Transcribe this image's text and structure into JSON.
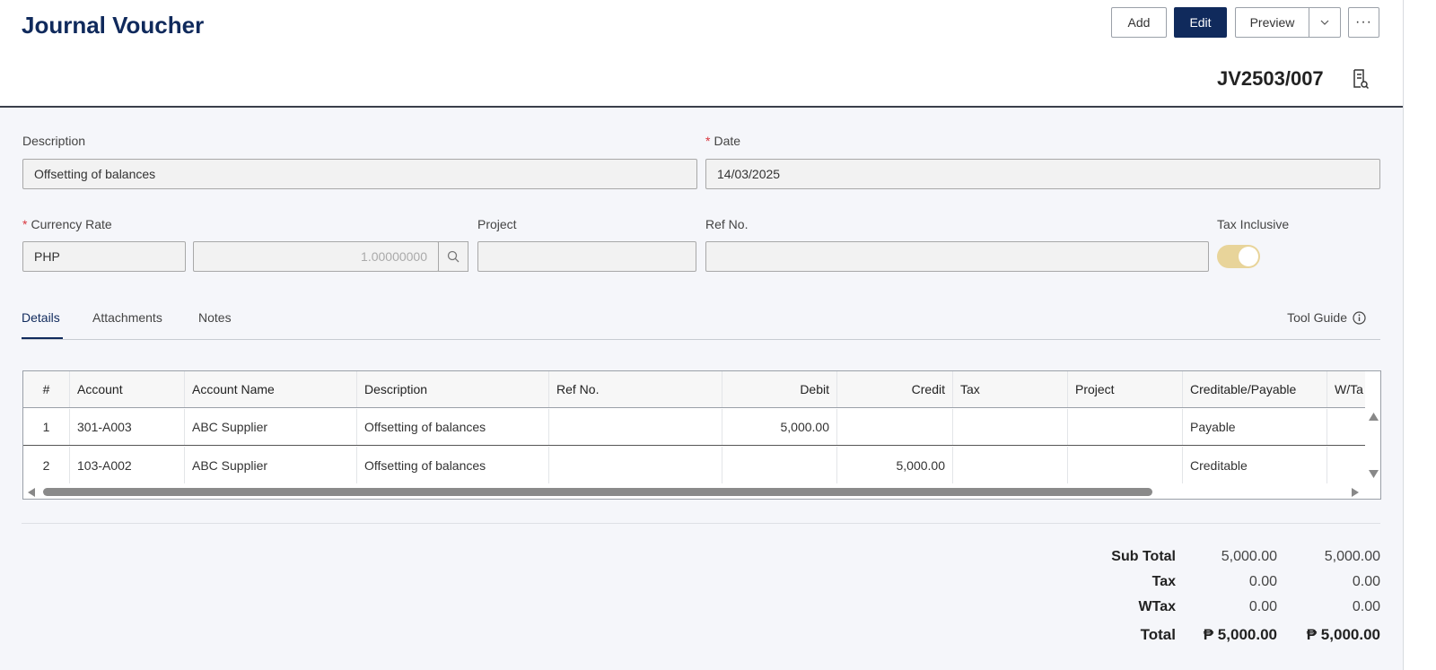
{
  "header": {
    "title": "Journal Voucher",
    "add_label": "Add",
    "edit_label": "Edit",
    "preview_label": "Preview",
    "more_label": "···",
    "doc_number": "JV2503/007"
  },
  "form": {
    "description_label": "Description",
    "description_value": "Offsetting of balances",
    "date_label": "Date",
    "date_value": "14/03/2025",
    "currency_rate_label": "Currency Rate",
    "currency_value": "PHP",
    "rate_value": "1.00000000",
    "project_label": "Project",
    "project_value": "",
    "ref_no_label": "Ref No.",
    "ref_no_value": "",
    "tax_inclusive_label": "Tax Inclusive",
    "tax_inclusive_on": true,
    "required_mark": "*"
  },
  "tabs": {
    "details": "Details",
    "attachments": "Attachments",
    "notes": "Notes",
    "tool_guide": "Tool Guide"
  },
  "table": {
    "columns": [
      "#",
      "Account",
      "Account Name",
      "Description",
      "Ref No.",
      "Debit",
      "Credit",
      "Tax",
      "Project",
      "Creditable/Payable",
      "W/Ta"
    ],
    "rows": [
      {
        "num": "1",
        "account": "301-A003",
        "account_name": "ABC Supplier",
        "description": "Offsetting of balances",
        "ref_no": "",
        "debit": "5,000.00",
        "credit": "",
        "tax": "",
        "project": "",
        "cp": "Payable",
        "wtax": ""
      },
      {
        "num": "2",
        "account": "103-A002",
        "account_name": "ABC Supplier",
        "description": "Offsetting of balances",
        "ref_no": "",
        "debit": "",
        "credit": "5,000.00",
        "tax": "",
        "project": "",
        "cp": "Creditable",
        "wtax": ""
      }
    ]
  },
  "totals": {
    "sub_total_label": "Sub Total",
    "sub_total_debit": "5,000.00",
    "sub_total_credit": "5,000.00",
    "tax_label": "Tax",
    "tax_debit": "0.00",
    "tax_credit": "0.00",
    "wtax_label": "WTax",
    "wtax_debit": "0.00",
    "wtax_credit": "0.00",
    "total_label": "Total",
    "total_debit": "₱ 5,000.00",
    "total_credit": "₱ 5,000.00"
  },
  "colors": {
    "primary": "#102a5c",
    "toggle_on": "#e8d49a",
    "required": "#d9363e"
  }
}
